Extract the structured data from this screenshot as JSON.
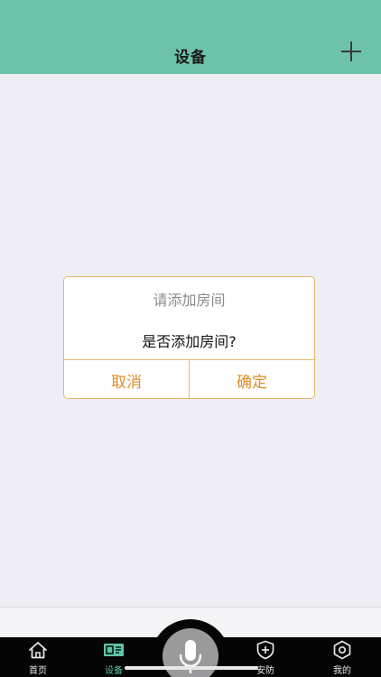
{
  "header": {
    "title": "设备",
    "add_icon": "plus-icon"
  },
  "dialog": {
    "title": "请添加房间",
    "message": "是否添加房间?",
    "cancel_label": "取消",
    "confirm_label": "确定"
  },
  "tabbar": {
    "tabs": [
      {
        "label": "首页",
        "icon": "home-icon"
      },
      {
        "label": "设备",
        "icon": "device-icon"
      },
      {
        "label": "安防",
        "icon": "shield-plus-icon"
      },
      {
        "label": "我的",
        "icon": "settings-icon"
      }
    ],
    "mic_icon": "microphone-icon",
    "active_tab": "设备"
  },
  "colors": {
    "header_bg": "#6cc3a9",
    "dialog_border": "#e8b66a",
    "dialog_button_text": "#e08c2a",
    "tab_active": "#5cc6a6",
    "tabbar_bg": "#050505",
    "page_bg": "#efeef4"
  }
}
